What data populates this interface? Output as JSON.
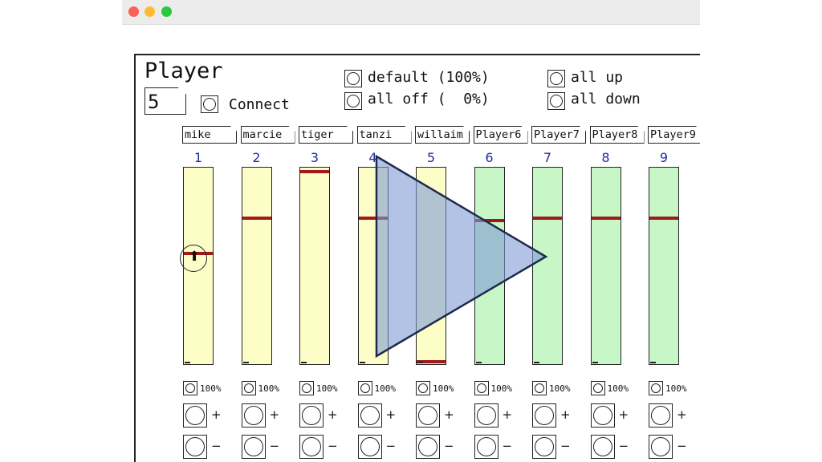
{
  "window": {
    "controls": [
      "close",
      "minimize",
      "zoom"
    ]
  },
  "patch": {
    "title": "Player",
    "player_number": "5",
    "connect_label": "Connect",
    "default_label": "default (100%)",
    "all_off_label": "all off (  0%)",
    "all_up_label": "all up",
    "all_down_label": "all down"
  },
  "channels": [
    {
      "name": "mike",
      "number": "1",
      "color": "yellow",
      "level": 0.57,
      "pct_label": "100%",
      "plus": "+",
      "minus": "−"
    },
    {
      "name": "marcie",
      "number": "2",
      "color": "yellow",
      "level": 0.75,
      "pct_label": "100%",
      "plus": "+",
      "minus": "−"
    },
    {
      "name": "tiger",
      "number": "3",
      "color": "yellow",
      "level": 0.99,
      "pct_label": "100%",
      "plus": "+",
      "minus": "−"
    },
    {
      "name": "tanzi",
      "number": "4",
      "color": "yellow",
      "level": 0.75,
      "pct_label": "100%",
      "plus": "+",
      "minus": "−"
    },
    {
      "name": "willaim",
      "number": "5",
      "color": "yellow",
      "level": 0.01,
      "pct_label": "100%",
      "plus": "+",
      "minus": "−"
    },
    {
      "name": "Player6",
      "number": "6",
      "color": "green",
      "level": 0.74,
      "pct_label": "100%",
      "plus": "+",
      "minus": "−"
    },
    {
      "name": "Player7",
      "number": "7",
      "color": "green",
      "level": 0.75,
      "pct_label": "100%",
      "plus": "+",
      "minus": "−"
    },
    {
      "name": "Player8",
      "number": "8",
      "color": "green",
      "level": 0.75,
      "pct_label": "100%",
      "plus": "+",
      "minus": "−"
    },
    {
      "name": "Player9",
      "number": "9",
      "color": "green",
      "level": 0.75,
      "pct_label": "100%",
      "plus": "+",
      "minus": "−"
    }
  ],
  "overlay": {
    "icon": "play-icon",
    "fill": "#7f9bd6",
    "stroke": "#1f2a4a"
  },
  "colors": {
    "slider_yellow": "#fdfdc8",
    "slider_green": "#c7f7c7",
    "knob": "#a11a1a",
    "channel_number": "#1f2fa0"
  }
}
